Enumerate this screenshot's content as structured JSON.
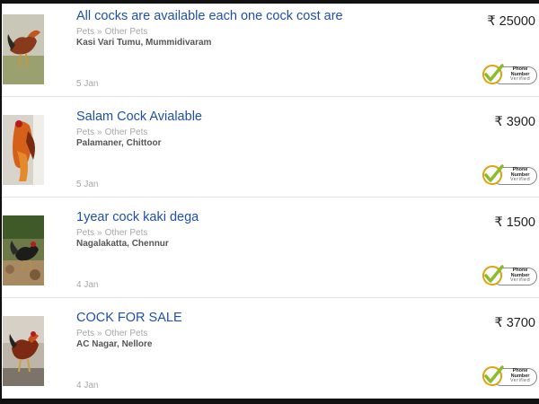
{
  "listings": [
    {
      "title": "All cocks are available each one cock cost are",
      "category": "Pets",
      "subcategory": "Other Pets",
      "location": "Kasi Vari Tumu, Mummidivaram",
      "date": "5 Jan",
      "price": "₹ 25000",
      "verified_line1": "Phone",
      "verified_line2": "Number",
      "verified_line3": "Verified"
    },
    {
      "title": "Salam Cock Avialable",
      "category": "Pets",
      "subcategory": "Other Pets",
      "location": "Palamaner, Chittoor",
      "date": "5 Jan",
      "price": "₹ 3900",
      "verified_line1": "Phone",
      "verified_line2": "Number",
      "verified_line3": "Verified"
    },
    {
      "title": "1year cock kaki dega",
      "category": "Pets",
      "subcategory": "Other Pets",
      "location": "Nagalakatta, Chennur",
      "date": "4 Jan",
      "price": "₹ 1500",
      "verified_line1": "Phone",
      "verified_line2": "Number",
      "verified_line3": "Verified"
    },
    {
      "title": "COCK FOR SALE",
      "category": "Pets",
      "subcategory": "Other Pets",
      "location": "AC Nagar, Nellore",
      "date": "4 Jan",
      "price": "₹ 3700",
      "verified_line1": "Phone",
      "verified_line2": "Number",
      "verified_line3": "Verified"
    }
  ],
  "separator": "»",
  "colors": {
    "title": "#1f50a6",
    "meta": "#a7a7a7",
    "tick": "#8dbb2a",
    "badge_ring": "#e0a010"
  }
}
